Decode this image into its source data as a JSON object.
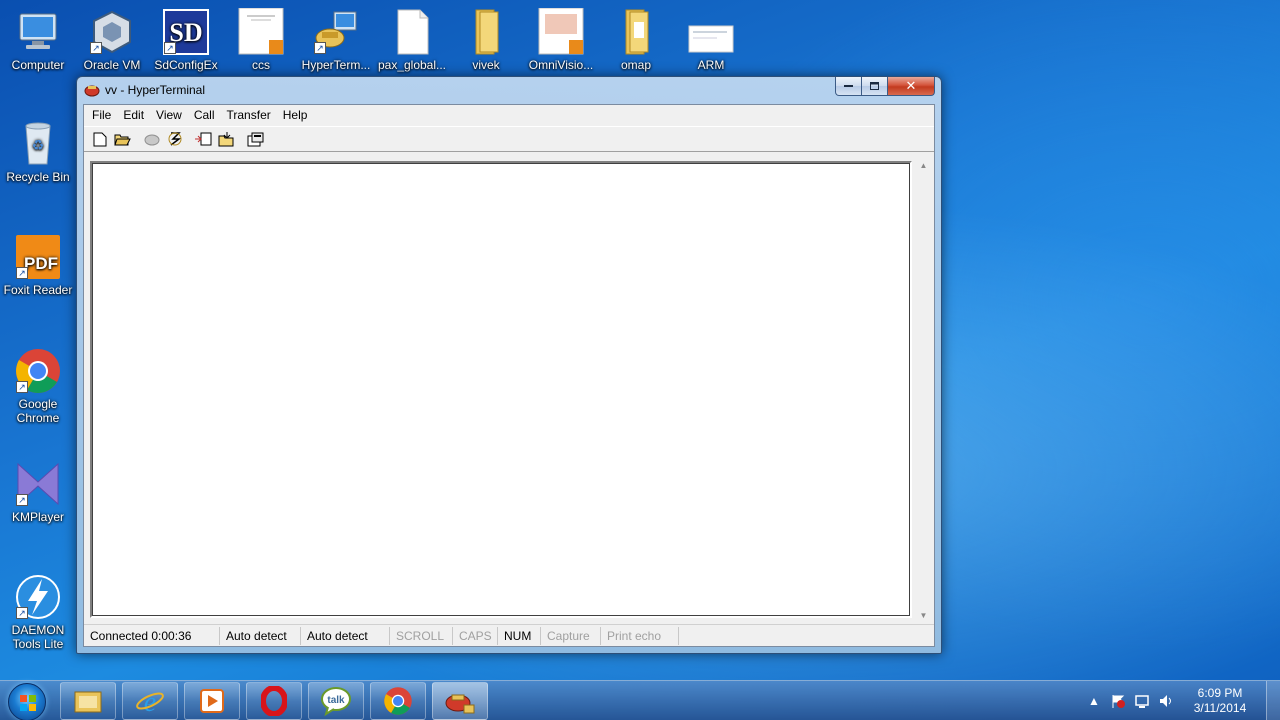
{
  "desktop": {
    "icons": [
      {
        "label": "Computer"
      },
      {
        "label": "Oracle VM"
      },
      {
        "label": "SdConfigEx"
      },
      {
        "label": "ccs"
      },
      {
        "label": "HyperTerm..."
      },
      {
        "label": "pax_global..."
      },
      {
        "label": "vivek"
      },
      {
        "label": "OmniVisio..."
      },
      {
        "label": "omap"
      },
      {
        "label": "ARM"
      },
      {
        "label": "Recycle Bin"
      },
      {
        "label": "Foxit Reader"
      },
      {
        "label": "Google Chrome"
      },
      {
        "label": "KMPlayer"
      },
      {
        "label": "DAEMON Tools Lite"
      }
    ]
  },
  "window": {
    "title": "vv - HyperTerminal",
    "menu": [
      "File",
      "Edit",
      "View",
      "Call",
      "Transfer",
      "Help"
    ],
    "toolbar_icons": [
      "new-file-icon",
      "open-folder-icon",
      "disconnect-icon",
      "dial-icon",
      "send-file-icon",
      "receive-file-icon",
      "properties-icon"
    ],
    "status": {
      "connection": "Connected 0:00:36",
      "detect1": "Auto detect",
      "detect2": "Auto detect",
      "scroll": "SCROLL",
      "caps": "CAPS",
      "num": "NUM",
      "capture": "Capture",
      "print_echo": "Print echo"
    }
  },
  "taskbar": {
    "apps": [
      "file-explorer-icon",
      "internet-explorer-icon",
      "media-player-icon",
      "opera-icon",
      "google-talk-icon",
      "chrome-icon",
      "hyperterminal-icon"
    ],
    "tray_icons": [
      "show-hidden-icons-arrow",
      "action-center-flag-icon",
      "network-icon",
      "volume-icon"
    ],
    "clock": {
      "time": "6:09 PM",
      "date": "3/11/2014"
    }
  },
  "colors": {
    "close_button": "#c23a1f",
    "desktop_blue": "#1976d2"
  }
}
